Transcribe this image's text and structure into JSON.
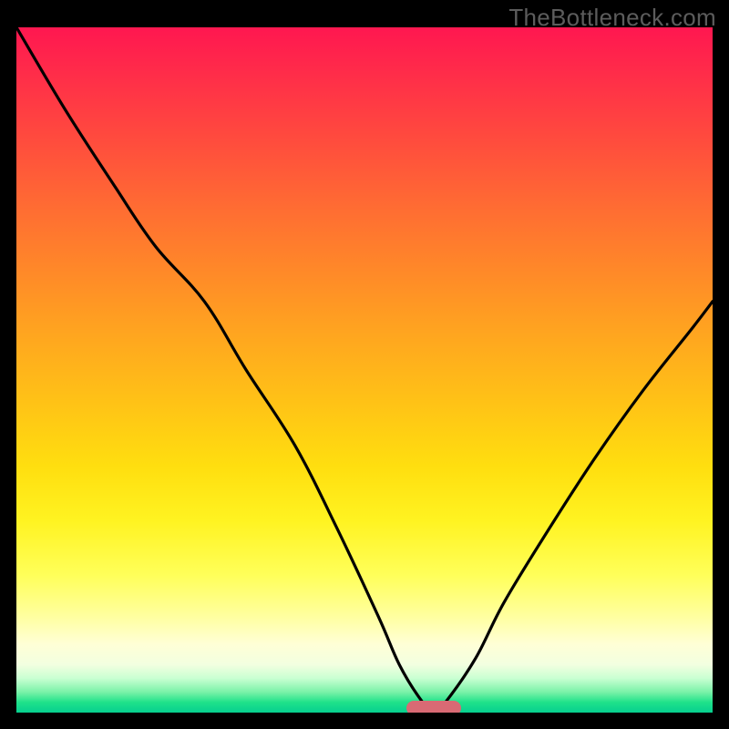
{
  "watermark": "TheBottleneck.com",
  "colors": {
    "frame": "#000000",
    "curve": "#000000",
    "marker": "#d96a74",
    "watermark_text": "#5c5c5c"
  },
  "chart_data": {
    "type": "line",
    "title": "",
    "xlabel": "",
    "ylabel": "",
    "xlim": [
      0,
      100
    ],
    "ylim": [
      0,
      100
    ],
    "grid": false,
    "legend": false,
    "series": [
      {
        "name": "bottleneck-curve",
        "x": [
          0,
          7,
          14,
          20,
          27,
          33,
          40,
          46,
          52,
          55,
          58,
          60,
          62,
          66,
          70,
          76,
          83,
          90,
          97,
          100
        ],
        "values": [
          100,
          88,
          77,
          68,
          60,
          50,
          39,
          27,
          14,
          7,
          2,
          0,
          2,
          8,
          16,
          26,
          37,
          47,
          56,
          60
        ]
      }
    ],
    "annotations": [
      {
        "name": "min-marker",
        "x": 60,
        "y": 0,
        "shape": "pill",
        "color": "#d96a74"
      }
    ],
    "background_gradient_stops": [
      {
        "pos": 0.0,
        "color": "#ff1750"
      },
      {
        "pos": 0.36,
        "color": "#ff8a28"
      },
      {
        "pos": 0.72,
        "color": "#fff321"
      },
      {
        "pos": 0.9,
        "color": "#ffffd6"
      },
      {
        "pos": 1.0,
        "color": "#06cf8f"
      }
    ]
  }
}
